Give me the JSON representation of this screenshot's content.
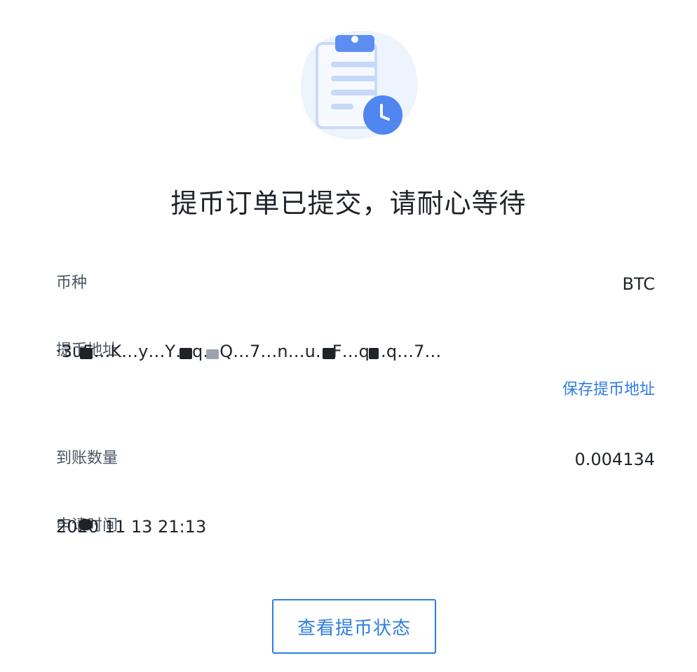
{
  "hero": {
    "icon": "clipboard-clock-icon",
    "colors": {
      "blob": "#eef4fd",
      "paper": "#f6f9ff",
      "paper_border": "#c9dafb",
      "lines": "#c7d8f8",
      "clip": "#5b8ef0",
      "clock_bg": "#4f86f0"
    }
  },
  "title": "提币订单已提交，请耐心等待",
  "rows": {
    "currency": {
      "label": "币种",
      "value": "BTC"
    },
    "address": {
      "label": "提币地址",
      "value": "·3u5…K…y…Y…q…Q…7…n…u…F…q…q…7…"
    },
    "amount": {
      "label": "到账数量",
      "value": "0.004134"
    },
    "time": {
      "label": "申请时间",
      "value": "2020 11 13 21:13"
    }
  },
  "save_address_link": "保存提币地址",
  "status_button": "查看提币状态",
  "colors": {
    "accent": "#2f7de1",
    "text": "#1f2329",
    "label": "#4b5563"
  }
}
